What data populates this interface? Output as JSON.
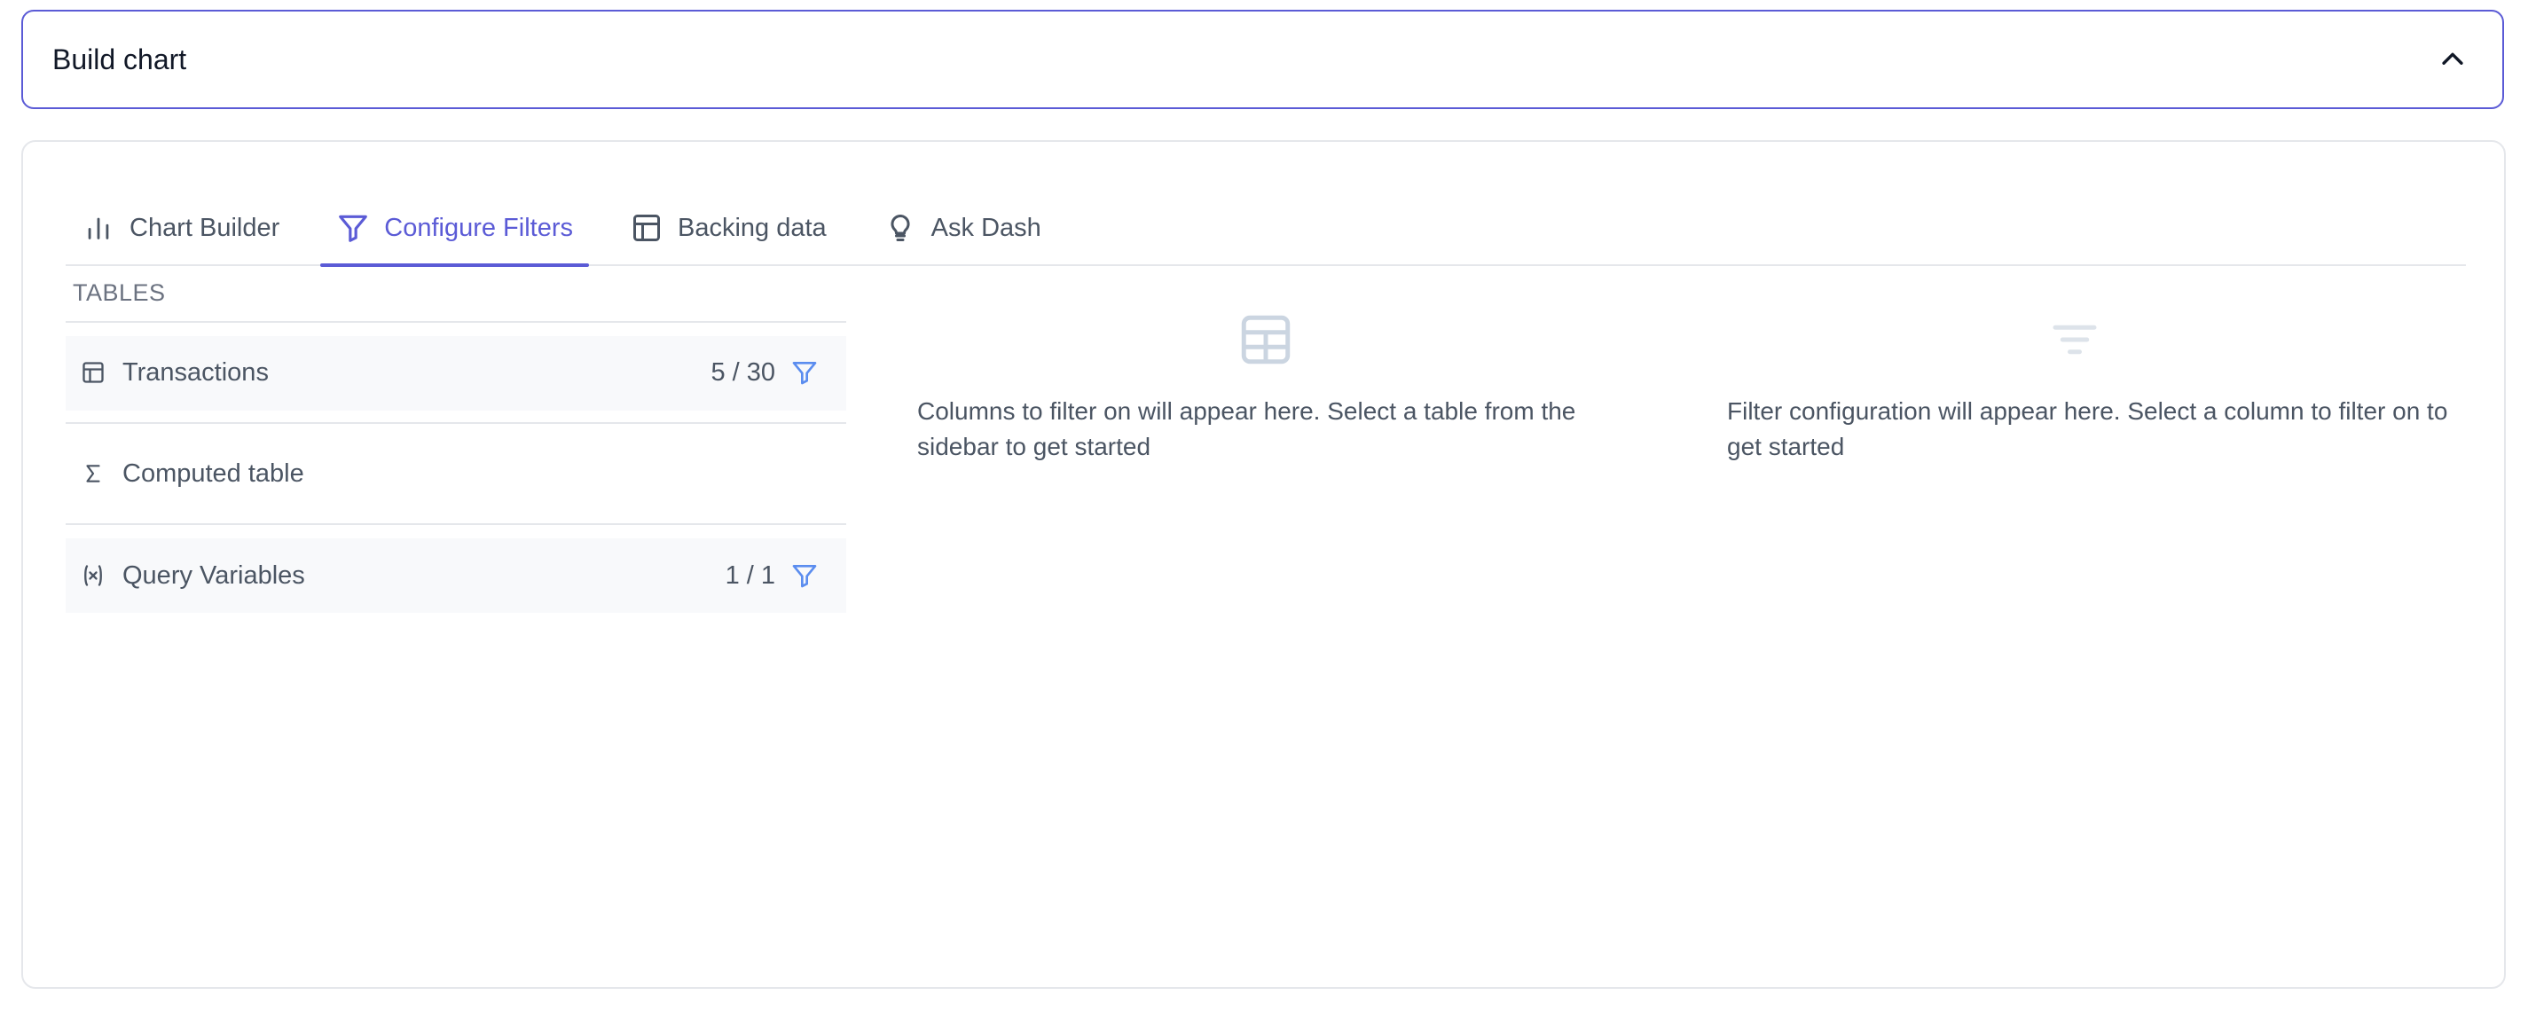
{
  "accordion": {
    "title": "Build chart",
    "chevron_icon": "chevron-up-icon"
  },
  "tabs": [
    {
      "label": "Chart Builder",
      "icon": "bar-chart-icon",
      "active": false
    },
    {
      "label": "Configure Filters",
      "icon": "filter-icon",
      "active": true
    },
    {
      "label": "Backing data",
      "icon": "table-icon",
      "active": false
    },
    {
      "label": "Ask Dash",
      "icon": "lightbulb-icon",
      "active": false
    }
  ],
  "sidebar": {
    "section_label": "TABLES",
    "items": [
      {
        "label": "Transactions",
        "icon": "table-icon",
        "count": "5 / 30",
        "filter_icon": "filter-icon"
      },
      {
        "label": "Computed table",
        "icon": "sigma-icon",
        "count": "",
        "filter_icon": ""
      },
      {
        "label": "Query Variables",
        "icon": "variable-icon",
        "count": "1 / 1",
        "filter_icon": "filter-icon"
      }
    ]
  },
  "columns_panel": {
    "icon": "table-grid-icon",
    "message": "Columns to filter on will appear here. Select a table from the sidebar to get started"
  },
  "config_panel": {
    "icon": "filter-lines-icon",
    "message": "Filter configuration will appear here. Select a column to filter on to get started"
  },
  "colors": {
    "accent": "#5b5bd6",
    "border": "#e5e7eb",
    "text": "#4b5563",
    "muted_icon": "#cbd5e1",
    "filter_icon": "#5b8def"
  }
}
